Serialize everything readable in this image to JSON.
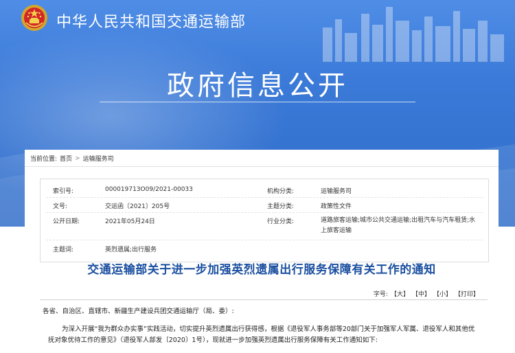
{
  "header": {
    "ministry_name": "中华人民共和国交通运输部",
    "page_headline": "政府信息公开"
  },
  "breadcrumb": {
    "prefix": "当前位置:",
    "items": [
      "首页",
      "运输服务司"
    ],
    "separator": ">"
  },
  "metadata": {
    "rows": [
      {
        "k1": "索引号:",
        "v1": "000019713O09/2021-00033",
        "k2": "机构分类:",
        "v2": "运输服务司"
      },
      {
        "k1": "文号:",
        "v1": "交运函〔2021〕205号",
        "k2": "主题分类:",
        "v2": "政策性文件"
      },
      {
        "k1": "公开日期:",
        "v1": "2021年05月24日",
        "k2": "行业分类:",
        "v2": "道路旅客运输;城市公共交通运输;出租汽车与汽车租赁;水上旅客运输"
      },
      {
        "k1": "主题词:",
        "v1": "英烈遗属;出行服务",
        "k2": "",
        "v2": ""
      }
    ]
  },
  "document": {
    "title": "交通运输部关于进一步加强英烈遗属出行服务保障有关工作的通知",
    "font_size_label": "字号:",
    "font_size_options": [
      "【大】",
      "【中】",
      "【小】",
      "【打印】"
    ],
    "salutation": "各省、自治区、直辖市、新疆生产建设兵团交通运输厅（局、委）:",
    "paragraph_1": "为深入开展“我为群众办实事”实践活动，切实提升英烈遗属出行获得感，根据《退役军人事务部等20部门关于加强军人军属、退役军人和其他优抚对象优待工作的意见》（退役军人部发〔2020〕1号），现就进一步加强英烈遗属出行服务保障有关工作通知如下:"
  },
  "colors": {
    "banner_blue": "#3b7ad8",
    "title_blue": "#1a4fa0"
  }
}
